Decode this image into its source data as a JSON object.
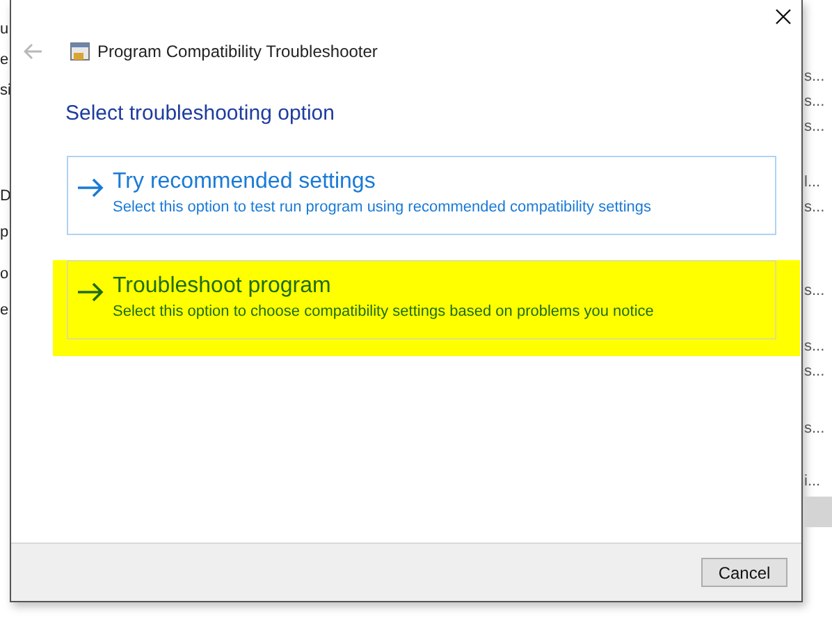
{
  "background_left": [
    "u",
    "e",
    "si",
    "D",
    "p",
    "o",
    "e"
  ],
  "background_right": [
    "s...",
    "s...",
    "s...",
    "l...",
    "s...",
    "s...",
    "s...",
    "s...",
    "s...",
    "i..."
  ],
  "dialog": {
    "title": "Program Compatibility Troubleshooter",
    "heading": "Select troubleshooting option",
    "options": [
      {
        "title": "Try recommended settings",
        "description": "Select this option to test run program using recommended compatibility settings",
        "highlighted": false
      },
      {
        "title": "Troubleshoot program",
        "description": "Select this option to choose compatibility settings based on problems you notice",
        "highlighted": true
      }
    ],
    "buttons": [
      "Cancel"
    ]
  }
}
